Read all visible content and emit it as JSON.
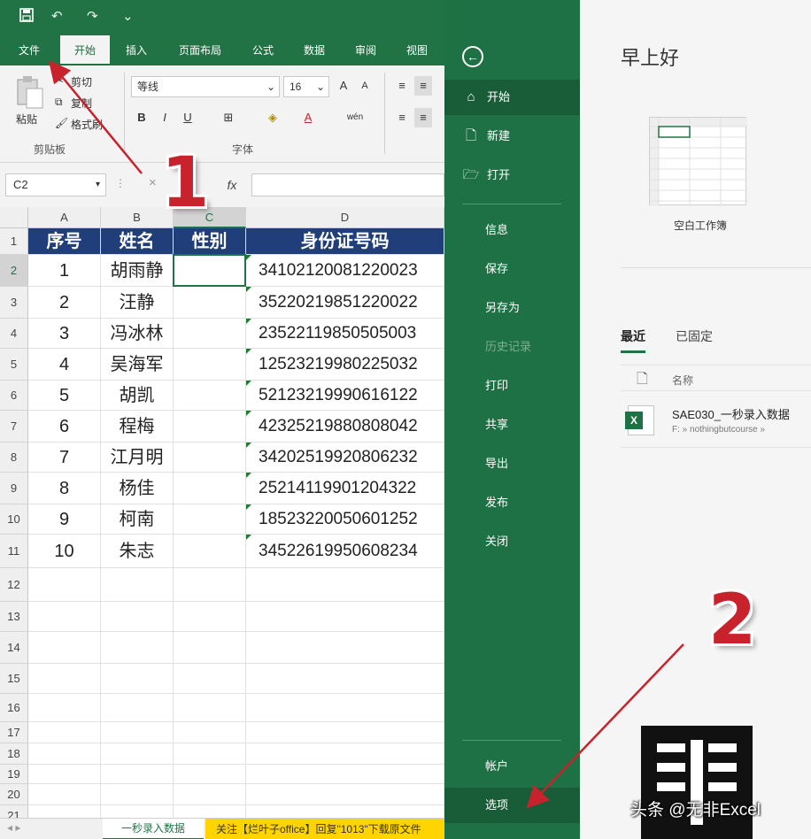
{
  "excel": {
    "qat": {
      "save_icon": "save-icon",
      "undo": "↶",
      "redo": "↷",
      "more": "⌄"
    },
    "tabs": [
      "文件",
      "开始",
      "插入",
      "页面布局",
      "公式",
      "数据",
      "审阅",
      "视图"
    ],
    "ribbon": {
      "paste": "粘贴",
      "cut": "剪切",
      "copy": "复制",
      "format_painter": "格式刷",
      "clipboard_group": "剪贴板",
      "font_name": "等线",
      "font_size": "16",
      "grow": "A",
      "shrink": "A",
      "bold": "B",
      "italic": "I",
      "underline": "U",
      "font_color": "A",
      "wen": "wén",
      "font_group": "字体"
    },
    "formula": {
      "name_box": "C2",
      "fx": "fx",
      "value": ""
    },
    "columns": [
      "A",
      "B",
      "C",
      "D"
    ],
    "selected_column": "C",
    "header_row": [
      "序号",
      "姓名",
      "性别",
      "身份证号码"
    ],
    "rows": [
      [
        "1",
        "胡雨静",
        "",
        "34102120081220023"
      ],
      [
        "2",
        "汪静",
        "",
        "35220219851220022"
      ],
      [
        "3",
        "冯冰林",
        "",
        "23522119850505003"
      ],
      [
        "4",
        "吴海军",
        "",
        "12523219980225032"
      ],
      [
        "5",
        "胡凯",
        "",
        "52123219990616122"
      ],
      [
        "6",
        "程梅",
        "",
        "42325219880808042"
      ],
      [
        "7",
        "江月明",
        "",
        "34202519920806232"
      ],
      [
        "8",
        "杨佳",
        "",
        "25214119901204322"
      ],
      [
        "9",
        "柯南",
        "",
        "18523220050601252"
      ],
      [
        "10",
        "朱志",
        "",
        "34522619950608234"
      ]
    ],
    "row_numbers": [
      "1",
      "2",
      "3",
      "4",
      "5",
      "6",
      "7",
      "8",
      "9",
      "10",
      "11",
      "12",
      "13",
      "14",
      "15",
      "16",
      "17",
      "18",
      "19",
      "20",
      "21"
    ],
    "selected_row": "2",
    "sheets": [
      "一秒录入数据",
      "关注【烂叶子office】回复\"1013\"下载原文件"
    ],
    "colors": {
      "ribbon_green": "#217346",
      "header_navy": "#203e7a",
      "sheet_highlight": "#ffd400"
    }
  },
  "backstage": {
    "nav_top": [
      {
        "label": "开始",
        "icon": "home-icon",
        "glyph": "⌂"
      },
      {
        "label": "新建",
        "icon": "new-document-icon",
        "glyph": "🗋"
      },
      {
        "label": "打开",
        "icon": "open-folder-icon",
        "glyph": "🗁"
      }
    ],
    "nav_mid": [
      "信息",
      "保存",
      "另存为",
      "历史记录",
      "打印",
      "共享",
      "导出",
      "发布",
      "关闭"
    ],
    "disabled": "历史记录",
    "nav_bottom": [
      "帐户",
      "选项"
    ],
    "greeting": "早上好",
    "blank_workbook": "空白工作簿",
    "recent_tabs": [
      "最近",
      "已固定"
    ],
    "list_name_header": "名称",
    "recent_file": {
      "name": "SAE030_一秒录入数据",
      "path": "F: » nothingbutcourse »"
    },
    "colors": {
      "nav_green": "#1e7145",
      "nav_active": "#185c38"
    }
  },
  "annotations": {
    "step1": "1",
    "step2": "2",
    "arrow_color": "#c8232c"
  },
  "watermark": "头条 @无非Excel"
}
